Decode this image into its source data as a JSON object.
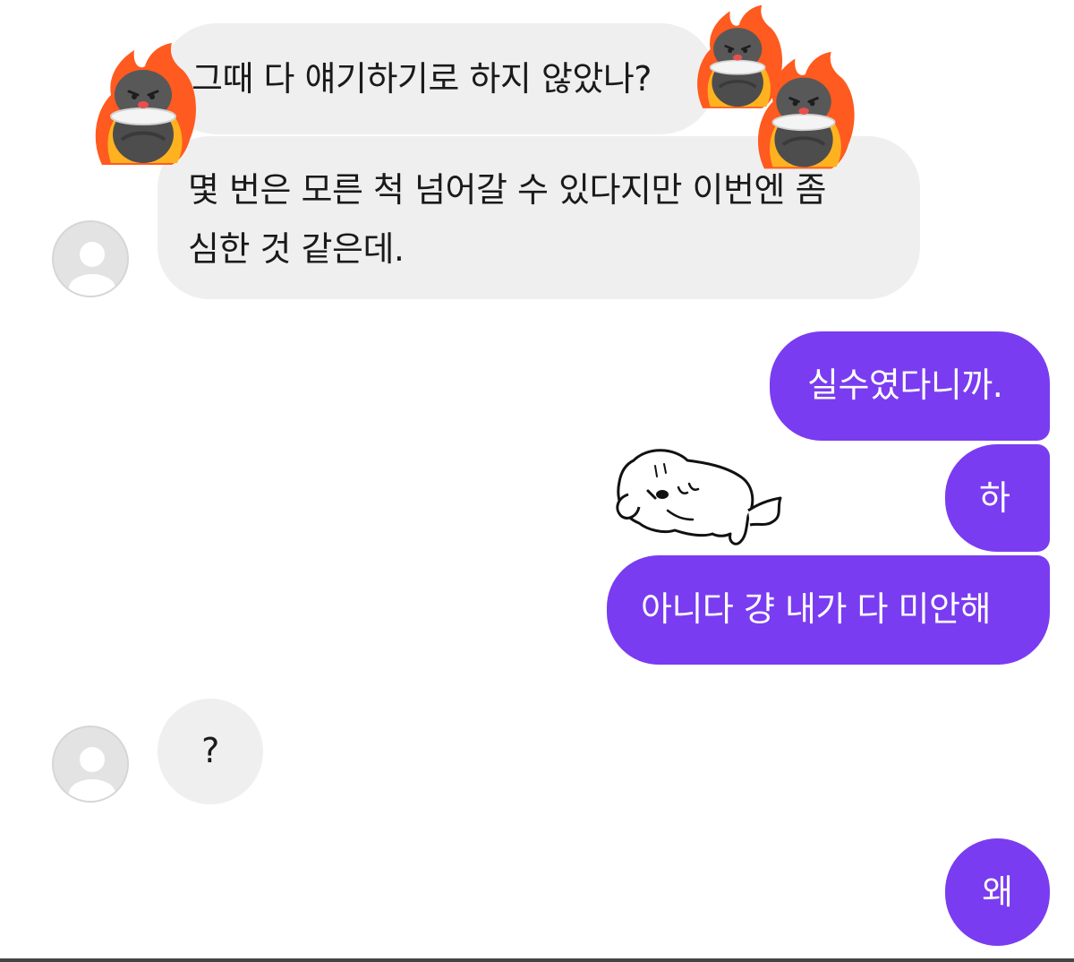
{
  "messages": {
    "m1": "그때 다 얘기하기로 하지 않았나?",
    "m2_line1": "몇 번은 모른 척 넘어갈 수 있다지만 이번엔 좀",
    "m2_line2": "심한 것 같은데.",
    "m3": "실수였다니까.",
    "m4": "하",
    "m5": "아니다 걍 내가 다 미안해",
    "m6": "?",
    "m7": "왜"
  },
  "colors": {
    "outgoing_bubble": "#7a3cf0",
    "incoming_bubble": "#efefef",
    "background": "#ffffff"
  },
  "icons": {
    "avatar": "default-profile-icon",
    "sticker_crow": "angry-crow-fire-sticker",
    "sticker_dog": "tired-dog-lying-sticker"
  }
}
